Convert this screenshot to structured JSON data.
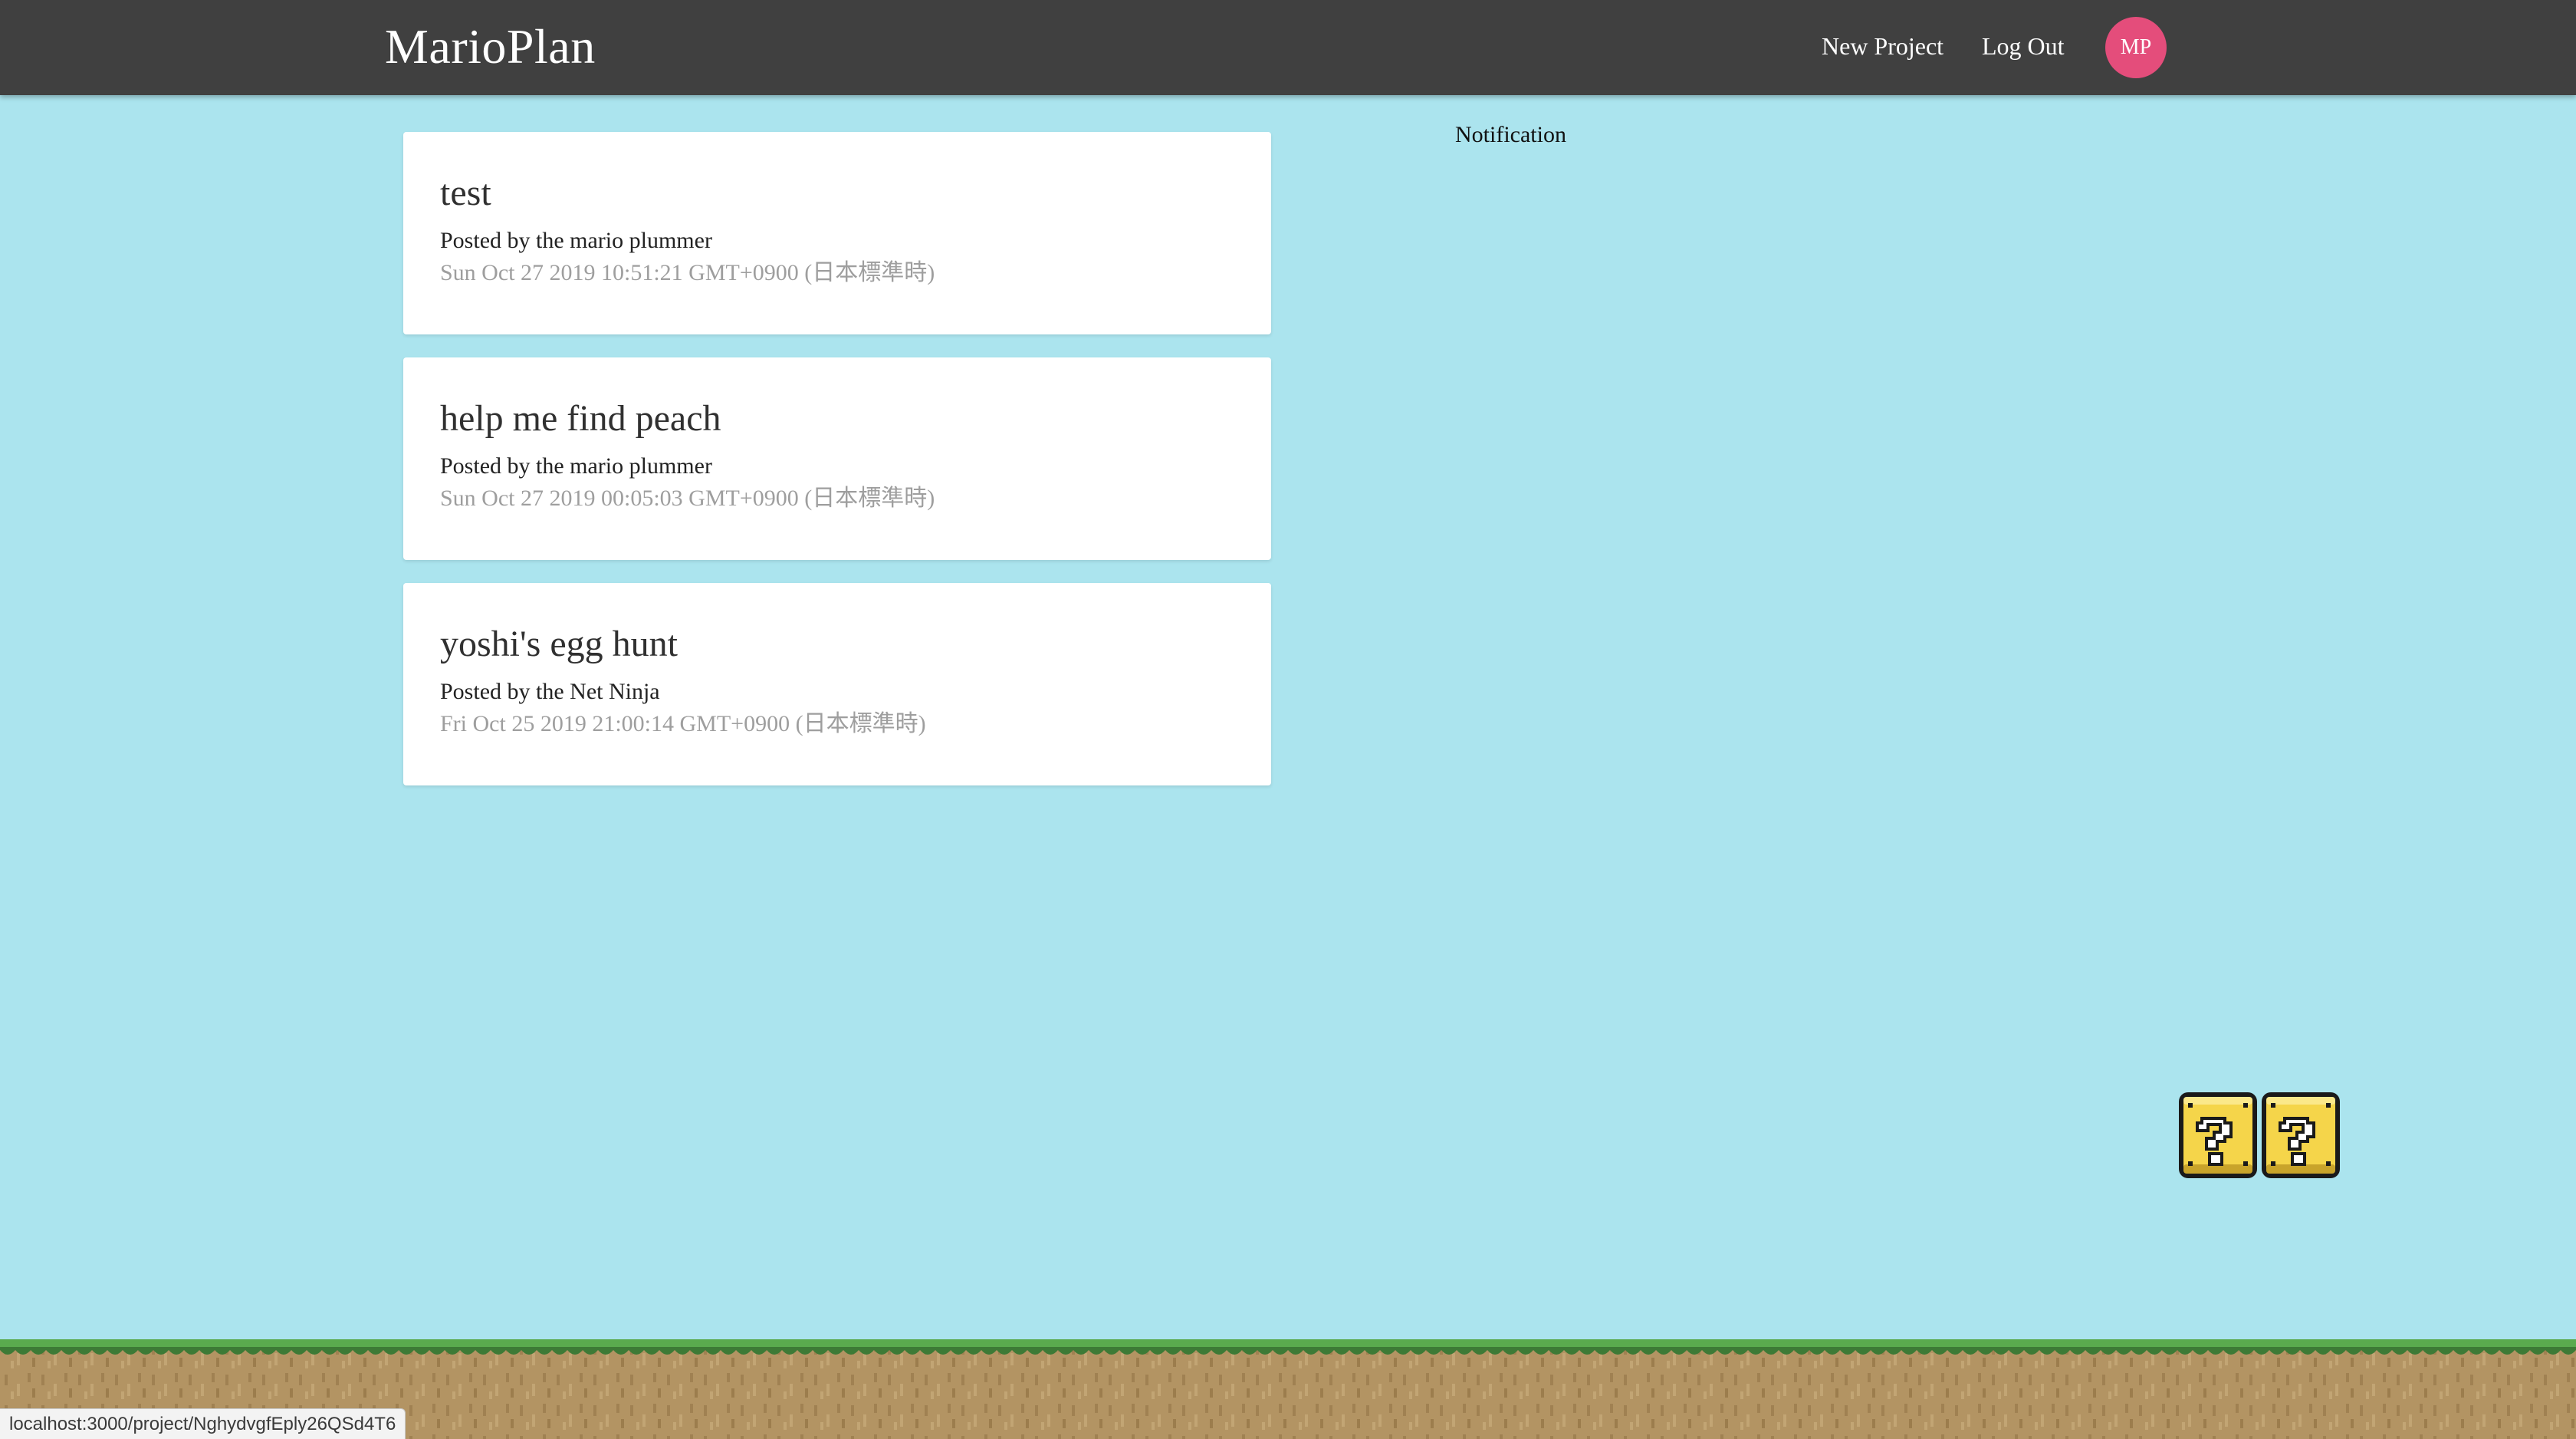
{
  "navbar": {
    "brand": "MarioPlan",
    "links": {
      "new_project": "New Project",
      "log_out": "Log Out"
    },
    "avatar_initials": "MP",
    "avatar_color": "#e44d7b",
    "background_color": "#404040"
  },
  "projects": [
    {
      "title": "test",
      "author": "Posted by the mario plummer",
      "date": "Sun Oct 27 2019 10:51:21 GMT+0900 (日本標準時)"
    },
    {
      "title": "help me find peach",
      "author": "Posted by the mario plummer",
      "date": "Sun Oct 27 2019 00:05:03 GMT+0900 (日本標準時)"
    },
    {
      "title": "yoshi's egg hunt",
      "author": "Posted by the Net Ninja",
      "date": "Fri Oct 25 2019 21:00:14 GMT+0900 (日本標準時)"
    }
  ],
  "notifications": {
    "title": "Notification"
  },
  "decor": {
    "question_blocks_icon": "question-block-icon",
    "ground_icon": "grass-ground-icon",
    "page_background": "#abe4ee"
  },
  "status_bar": {
    "url": "localhost:3000/project/NghydvgfEply26QSd4T6"
  }
}
